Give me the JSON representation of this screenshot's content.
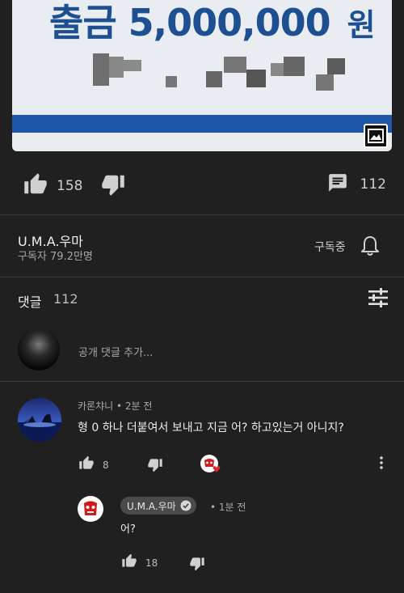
{
  "post_image": {
    "headline_prefix": "출금",
    "headline_amount": "5,000,000",
    "headline_suffix": "원",
    "accent_color": "#1d4f91",
    "badge_icon": "image-icon"
  },
  "actions": {
    "like_count": "158",
    "comment_count": "112",
    "icons": [
      "thumb-up-icon",
      "thumb-down-icon",
      "comment-icon"
    ]
  },
  "channel": {
    "name": "U.M.A.우마",
    "subscribers": "구독자 79.2만명",
    "subscribe_state": "구독중",
    "icon": "bell-icon"
  },
  "comments_header": {
    "title": "댓글",
    "count": "112",
    "sort_icon": "sort-icon"
  },
  "add_comment": {
    "placeholder": "공개 댓글 추가..."
  },
  "comment": {
    "author": "카론챠니",
    "time": "2분 전",
    "text": "형 0 하나 더붙여서 보내고 지금 어? 하고있는거 아니지?",
    "likes": "8"
  },
  "reply": {
    "author": "U.M.A.우마",
    "time": "1분 전",
    "text": "어?",
    "likes": "18"
  }
}
